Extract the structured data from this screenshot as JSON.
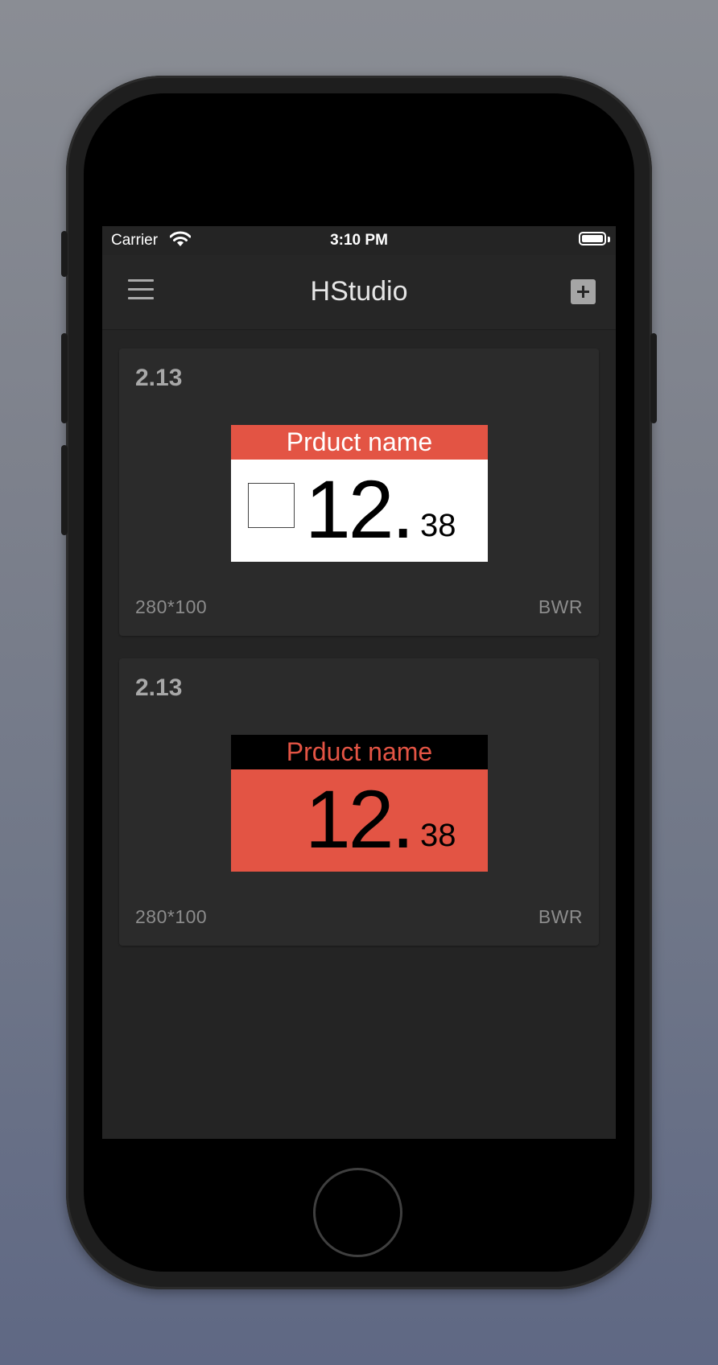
{
  "status_bar": {
    "carrier": "Carrier",
    "time": "3:10 PM",
    "wifi_icon": "wifi-icon",
    "battery_icon": "battery-icon"
  },
  "nav": {
    "title": "HStudio",
    "menu_icon": "hamburger-menu-icon",
    "add_icon": "plus-square-icon"
  },
  "colors": {
    "screen_bg": "#242424",
    "card_bg": "#2b2b2b",
    "accent_red": "#e35444",
    "label_white": "#ffffff",
    "label_black": "#000000"
  },
  "templates": [
    {
      "version": "2.13",
      "size": "280*100",
      "color_mode": "BWR",
      "preview": {
        "product_name": "Prduct name",
        "price_integer": "12.",
        "price_decimal": "38",
        "header_bg": "#e35444",
        "header_text_color": "#ffffff",
        "body_bg": "#ffffff",
        "has_checkbox": true
      }
    },
    {
      "version": "2.13",
      "size": "280*100",
      "color_mode": "BWR",
      "preview": {
        "product_name": "Prduct name",
        "price_integer": "12.",
        "price_decimal": "38",
        "header_bg": "#000000",
        "header_text_color": "#e35444",
        "body_bg": "#e35444",
        "has_checkbox": false
      }
    }
  ]
}
